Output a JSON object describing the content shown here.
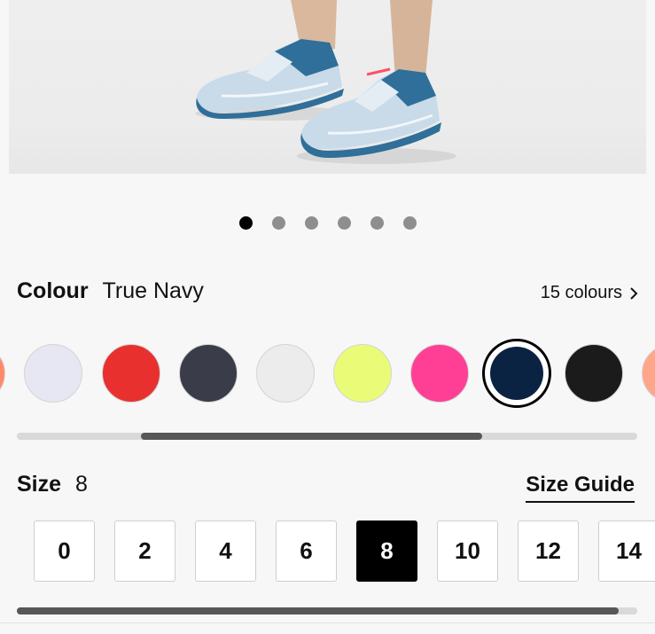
{
  "carousel": {
    "count": 6,
    "active_index": 0
  },
  "colour": {
    "label": "Colour",
    "selected_name": "True Navy",
    "count_text": "15 colours",
    "swatches": [
      {
        "name": "coral-partial",
        "color": "#ff8a6a"
      },
      {
        "name": "white-lavender",
        "color": "#e7e7f3"
      },
      {
        "name": "red",
        "color": "#e8312f"
      },
      {
        "name": "charcoal-camo",
        "color": "#3a3c4a"
      },
      {
        "name": "white",
        "color": "#ececec"
      },
      {
        "name": "neon-yellow",
        "color": "#eafc77"
      },
      {
        "name": "pink",
        "color": "#ff3f95"
      },
      {
        "name": "true-navy",
        "color": "#0b2342"
      },
      {
        "name": "black-print",
        "color": "#1b1b1b"
      },
      {
        "name": "peach-partial",
        "color": "#ffa68a"
      }
    ],
    "selected_index": 7,
    "scroll_fraction_start": 0.2,
    "scroll_fraction_end": 0.75
  },
  "size": {
    "label": "Size",
    "selected_value": "8",
    "guide_label": "Size Guide",
    "options": [
      "0",
      "2",
      "4",
      "6",
      "8",
      "10",
      "12",
      "14"
    ],
    "selected_index": 4,
    "scroll_fraction_start": 0.0,
    "scroll_fraction_end": 0.97
  },
  "colors": {
    "shoe_accent": "#2f6f99",
    "shoe_upper": "#c9dae8",
    "sole_pink": "#ff4f6b"
  }
}
